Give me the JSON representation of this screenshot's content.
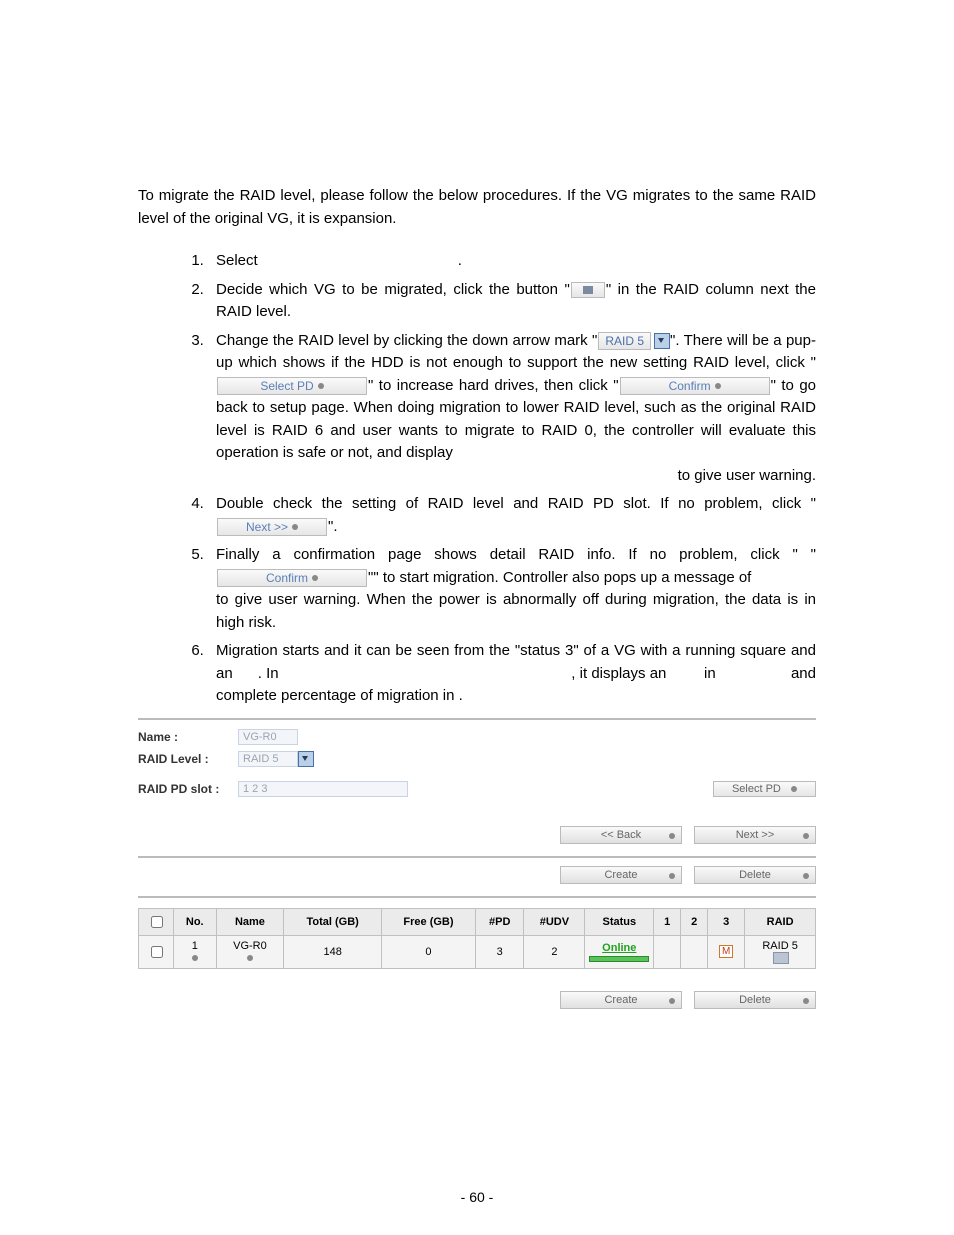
{
  "intro": "To migrate the RAID level, please follow the below procedures. If the VG migrates to the same RAID level of the original VG, it is expansion.",
  "steps": {
    "s1a": "Select",
    "s1b": ".",
    "s2a": "Decide which VG to be migrated, click the button \"",
    "s2b": "\" in the RAID column next the RAID level.",
    "s3a": "Change the RAID level by clicking the down arrow mark \"",
    "s3b": "\". There will be a pup-up which shows if the HDD is not enough to support the new setting RAID level, click \"",
    "s3c": "\" to increase hard drives, then click \"",
    "s3d": "\" to go back to setup page. When doing migration to lower RAID level, such as the original RAID level is RAID 6 and user wants to migrate to RAID 0, the controller will evaluate this operation is safe or not, and display",
    "s3e": "to give user warning.",
    "s4a": "Double check the setting of RAID level and RAID PD slot. If no problem, click \"",
    "s4b": "\".",
    "s5a": "Finally a confirmation page shows detail RAID info. If no problem, click \"",
    "s5b": "\" to start migration. Controller also pops up a message of",
    "s5c": "to give user warning. When the power is abnormally off during migration, the data is in high risk.",
    "s6a": "Migration starts and it can be seen from the \"status 3\" of a VG with a running square and an",
    "s6b": ". In",
    "s6c": ",",
    "s6d": "it displays an",
    "s6e": "in",
    "s6f": "and complete percentage of migration in",
    "s6g": "."
  },
  "inline_buttons": {
    "raid5": "RAID 5",
    "select_pd": "Select PD",
    "confirm": "Confirm",
    "next": "Next >>"
  },
  "panel": {
    "name_label": "Name :",
    "name_value": "VG-R0",
    "level_label": "RAID Level :",
    "level_value": "RAID 5",
    "pd_label": "RAID PD slot :",
    "pd_value": "1 2 3",
    "select_pd": "Select PD",
    "back": "<< Back",
    "next": "Next >>",
    "create": "Create",
    "delete": "Delete"
  },
  "table": {
    "headers": {
      "no": "No.",
      "name": "Name",
      "total": "Total (GB)",
      "free": "Free (GB)",
      "pd": "#PD",
      "udv": "#UDV",
      "status": "Status",
      "c1": "1",
      "c2": "2",
      "c3": "3",
      "raid": "RAID"
    },
    "row": {
      "no": "1",
      "name": "VG-R0",
      "total": "148",
      "free": "0",
      "pd": "3",
      "udv": "2",
      "status": "Online",
      "badge": "M",
      "raid": "RAID 5"
    }
  },
  "page_number": "- 60 -"
}
